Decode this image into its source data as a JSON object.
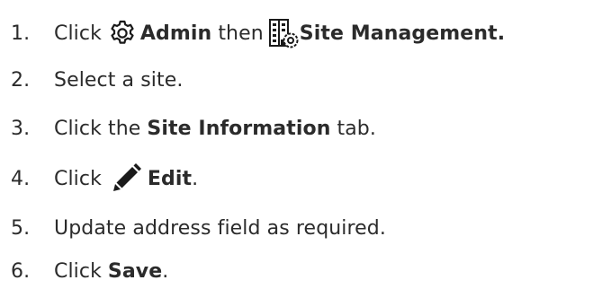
{
  "steps": [
    {
      "number": "1.",
      "parts": {
        "click": "Click",
        "admin_icon": "gear-icon",
        "admin": "Admin",
        "then": "then",
        "site_icon": "site-management-icon",
        "site_mgmt": "Site Management."
      }
    },
    {
      "number": "2.",
      "text": "Select a site."
    },
    {
      "number": "3.",
      "parts": {
        "click": "Click the",
        "tab_name": "Site Information",
        "tab": "tab."
      }
    },
    {
      "number": "4.",
      "parts": {
        "click": "Click",
        "edit_icon": "pencil-icon",
        "edit": "Edit",
        "period": "."
      }
    },
    {
      "number": "5.",
      "text": "Update address field as required."
    },
    {
      "number": "6.",
      "parts": {
        "click": "Click",
        "save": "Save",
        "period": "."
      }
    }
  ],
  "colors": {
    "text": "#2b2b2b",
    "icon": "#1a1a1a"
  }
}
